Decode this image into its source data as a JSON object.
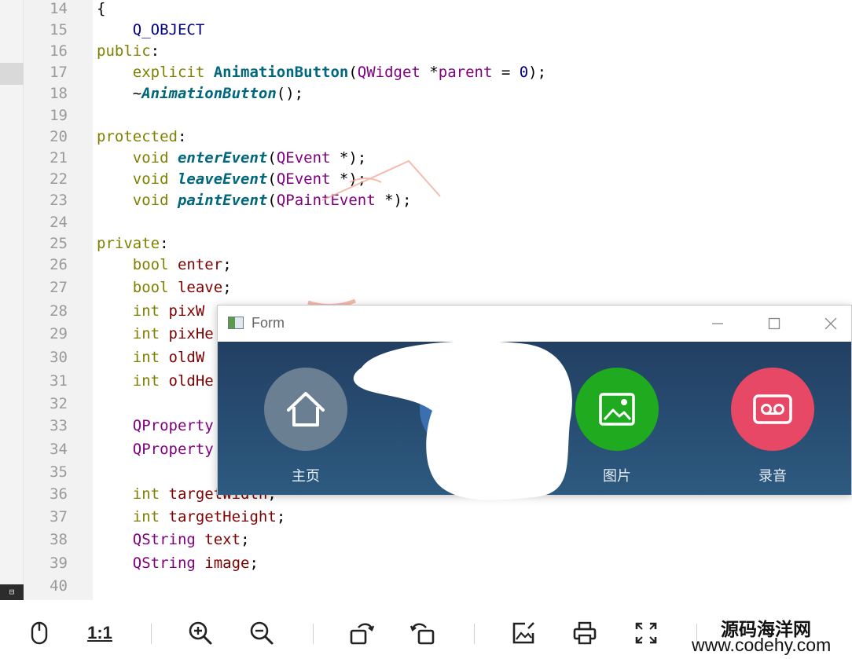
{
  "editor": {
    "lines": [
      {
        "n": "14",
        "segs": [
          {
            "t": "{",
            "c": ""
          }
        ]
      },
      {
        "n": "15",
        "segs": [
          {
            "t": "    Q_OBJECT",
            "c": "mc"
          }
        ]
      },
      {
        "n": "16",
        "segs": [
          {
            "t": "public",
            "c": "kw"
          },
          {
            "t": ":",
            "c": ""
          }
        ]
      },
      {
        "n": "17",
        "segs": [
          {
            "t": "    ",
            "c": ""
          },
          {
            "t": "explicit",
            "c": "kw"
          },
          {
            "t": " ",
            "c": ""
          },
          {
            "t": "AnimationButton",
            "c": "fn"
          },
          {
            "t": "(",
            "c": ""
          },
          {
            "t": "QWidget",
            "c": "ty"
          },
          {
            "t": " *",
            "c": ""
          },
          {
            "t": "parent",
            "c": "ty"
          },
          {
            "t": " = ",
            "c": ""
          },
          {
            "t": "0",
            "c": "nu"
          },
          {
            "t": ");",
            "c": ""
          }
        ]
      },
      {
        "n": "18",
        "segs": [
          {
            "t": "    ~",
            "c": ""
          },
          {
            "t": "AnimationButton",
            "c": "fi"
          },
          {
            "t": "();",
            "c": ""
          }
        ]
      },
      {
        "n": "19",
        "segs": []
      },
      {
        "n": "20",
        "segs": [
          {
            "t": "protected",
            "c": "kw"
          },
          {
            "t": ":",
            "c": ""
          }
        ]
      },
      {
        "n": "21",
        "segs": [
          {
            "t": "    ",
            "c": ""
          },
          {
            "t": "void",
            "c": "kw"
          },
          {
            "t": " ",
            "c": ""
          },
          {
            "t": "enterEvent",
            "c": "fi"
          },
          {
            "t": "(",
            "c": ""
          },
          {
            "t": "QEvent",
            "c": "ty"
          },
          {
            "t": " *);",
            "c": ""
          }
        ]
      },
      {
        "n": "22",
        "segs": [
          {
            "t": "    ",
            "c": ""
          },
          {
            "t": "void",
            "c": "kw"
          },
          {
            "t": " ",
            "c": ""
          },
          {
            "t": "leaveEvent",
            "c": "fi"
          },
          {
            "t": "(",
            "c": ""
          },
          {
            "t": "QEvent",
            "c": "ty"
          },
          {
            "t": " *);",
            "c": ""
          }
        ]
      },
      {
        "n": "23",
        "segs": [
          {
            "t": "    ",
            "c": ""
          },
          {
            "t": "void",
            "c": "kw"
          },
          {
            "t": " ",
            "c": ""
          },
          {
            "t": "paintEvent",
            "c": "fi"
          },
          {
            "t": "(",
            "c": ""
          },
          {
            "t": "QPaintEvent",
            "c": "ty"
          },
          {
            "t": " *);",
            "c": ""
          }
        ]
      },
      {
        "n": "24",
        "segs": []
      },
      {
        "n": "25",
        "segs": [
          {
            "t": "private",
            "c": "kw"
          },
          {
            "t": ":",
            "c": ""
          }
        ]
      },
      {
        "n": "26",
        "segs": [
          {
            "t": "    ",
            "c": ""
          },
          {
            "t": "bool",
            "c": "kw"
          },
          {
            "t": " ",
            "c": ""
          },
          {
            "t": "enter",
            "c": "va"
          },
          {
            "t": ";",
            "c": ""
          }
        ]
      },
      {
        "n": "27",
        "segs": [
          {
            "t": "    ",
            "c": ""
          },
          {
            "t": "bool",
            "c": "kw"
          },
          {
            "t": " ",
            "c": ""
          },
          {
            "t": "leave",
            "c": "va"
          },
          {
            "t": ";",
            "c": ""
          }
        ]
      },
      {
        "n": "28",
        "segs": [
          {
            "t": "    ",
            "c": ""
          },
          {
            "t": "int",
            "c": "kw"
          },
          {
            "t": " ",
            "c": ""
          },
          {
            "t": "pixW",
            "c": "va"
          }
        ]
      },
      {
        "n": "29",
        "segs": [
          {
            "t": "    ",
            "c": ""
          },
          {
            "t": "int",
            "c": "kw"
          },
          {
            "t": " ",
            "c": ""
          },
          {
            "t": "pixHe",
            "c": "va"
          }
        ]
      },
      {
        "n": "30",
        "segs": [
          {
            "t": "    ",
            "c": ""
          },
          {
            "t": "int",
            "c": "kw"
          },
          {
            "t": " ",
            "c": ""
          },
          {
            "t": "oldW",
            "c": "va"
          }
        ]
      },
      {
        "n": "31",
        "segs": [
          {
            "t": "    ",
            "c": ""
          },
          {
            "t": "int",
            "c": "kw"
          },
          {
            "t": " ",
            "c": ""
          },
          {
            "t": "oldHe",
            "c": "va"
          }
        ]
      },
      {
        "n": "32",
        "segs": []
      },
      {
        "n": "33",
        "segs": [
          {
            "t": "    ",
            "c": ""
          },
          {
            "t": "QProperty",
            "c": "ty"
          }
        ]
      },
      {
        "n": "34",
        "segs": [
          {
            "t": "    ",
            "c": ""
          },
          {
            "t": "QProperty",
            "c": "ty"
          }
        ]
      },
      {
        "n": "35",
        "segs": []
      },
      {
        "n": "36",
        "segs": [
          {
            "t": "    ",
            "c": ""
          },
          {
            "t": "int",
            "c": "kw"
          },
          {
            "t": " ",
            "c": ""
          },
          {
            "t": "targetWidth",
            "c": "va"
          },
          {
            "t": ";",
            "c": ""
          }
        ]
      },
      {
        "n": "37",
        "segs": [
          {
            "t": "    ",
            "c": ""
          },
          {
            "t": "int",
            "c": "kw"
          },
          {
            "t": " ",
            "c": ""
          },
          {
            "t": "targetHeight",
            "c": "va"
          },
          {
            "t": ";",
            "c": ""
          }
        ]
      },
      {
        "n": "38",
        "segs": [
          {
            "t": "    ",
            "c": ""
          },
          {
            "t": "QString",
            "c": "ty"
          },
          {
            "t": " ",
            "c": ""
          },
          {
            "t": "text",
            "c": "va"
          },
          {
            "t": ";",
            "c": ""
          }
        ]
      },
      {
        "n": "39",
        "segs": [
          {
            "t": "    ",
            "c": ""
          },
          {
            "t": "QString",
            "c": "ty"
          },
          {
            "t": " ",
            "c": ""
          },
          {
            "t": "image",
            "c": "va"
          },
          {
            "t": ";",
            "c": ""
          }
        ]
      },
      {
        "n": "40",
        "segs": []
      }
    ]
  },
  "form_window": {
    "title": "Form",
    "minimize_icon": "minimize-icon",
    "maximize_icon": "maximize-icon",
    "close_icon": "close-icon",
    "nav_items": [
      {
        "label": "主页",
        "icon": "home-icon",
        "color": "#6b7f93"
      },
      {
        "label": "",
        "icon": "redacted",
        "color": "#ffffff"
      },
      {
        "label": "图片",
        "icon": "image-icon",
        "color": "#1faa1f"
      },
      {
        "label": "录音",
        "icon": "cassette-icon",
        "color": "#e74866"
      }
    ]
  },
  "toolbar": {
    "buttons": [
      {
        "name": "mouse-icon"
      },
      {
        "name": "actual-size-button",
        "label": "1:1"
      },
      {
        "name": "zoom-in-icon"
      },
      {
        "name": "zoom-out-icon"
      },
      {
        "name": "rotate-left-icon"
      },
      {
        "name": "rotate-right-icon"
      },
      {
        "name": "edit-image-icon"
      },
      {
        "name": "print-icon"
      },
      {
        "name": "fullscreen-icon"
      }
    ],
    "actual_size_label": "1:1"
  },
  "brand": {
    "cn": "源码海洋网",
    "url": "www.codehy.com"
  },
  "accent": {
    "editor_gutter": "#f2f2f2",
    "form_bg": "#223f62",
    "image_green": "#1faa1f",
    "record_red": "#e74866"
  }
}
